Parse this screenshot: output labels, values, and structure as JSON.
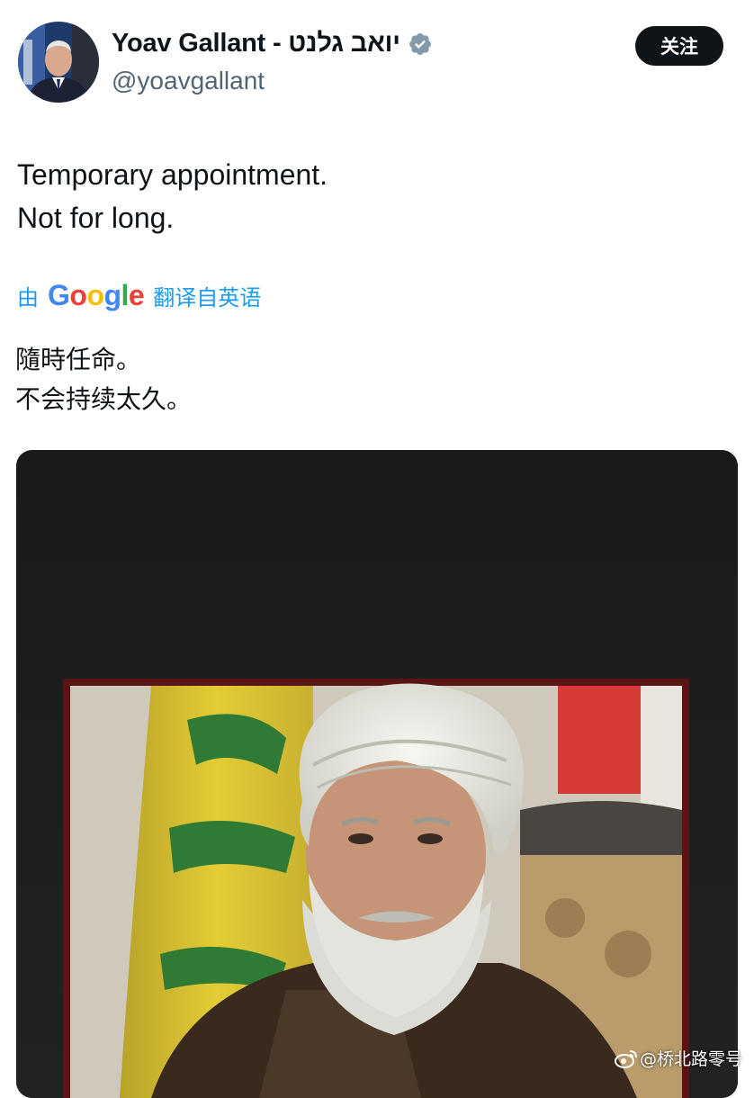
{
  "author": {
    "display_name": "Yoav Gallant - יואב גלנט",
    "handle": "@yoavgallant",
    "verified_icon": "verified-badge-icon",
    "avatar_icon": "avatar"
  },
  "actions": {
    "follow_label": "关注"
  },
  "tweet": {
    "lines": [
      "Temporary appointment.",
      "Not for long."
    ]
  },
  "translation": {
    "prefix": "由",
    "provider_letters": [
      "G",
      "o",
      "o",
      "g",
      "l",
      "e"
    ],
    "suffix": "翻译自英语",
    "lines": [
      "隨時任命。",
      "不会持续太久。"
    ]
  },
  "media": {
    "type": "photo"
  },
  "watermark": {
    "text": "@桥北路零号"
  },
  "colors": {
    "link": "#1d9bf0",
    "follow_bg": "#0f1419",
    "handle": "#536471",
    "verified": "#829aab",
    "google": [
      "#4285F4",
      "#EA4335",
      "#FBBC05",
      "#4285F4",
      "#34A853",
      "#EA4335"
    ]
  }
}
